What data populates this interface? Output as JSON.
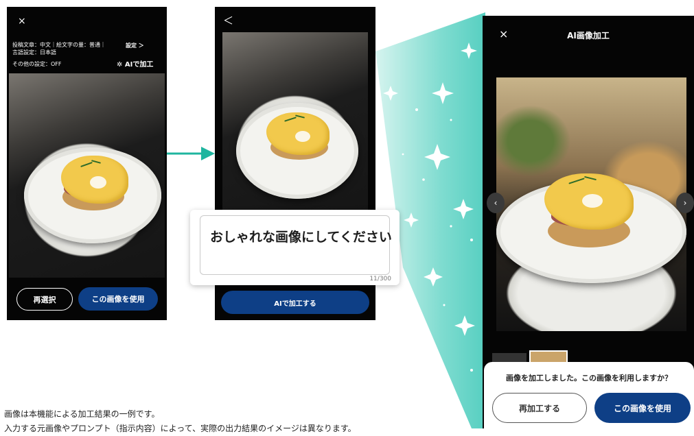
{
  "screen1": {
    "close_icon": "×",
    "settings_line1": "投稿文章：中文｜絵文字の量：普通｜",
    "settings_line2": "言語設定：日本語",
    "settings_line3": "その他の設定：OFF",
    "settings_link": "設定 ＞",
    "ai_edit": "AIで加工",
    "reselect_button": "再選択",
    "use_image_button": "この画像を使用"
  },
  "screen2": {
    "back_icon": "＜",
    "ai_process_button": "AIで加工する"
  },
  "prompt": {
    "text": "おしゃれな画像にしてください",
    "counter": "11/300"
  },
  "screen3": {
    "close_icon": "×",
    "title": "AI画像加工",
    "prev_icon": "‹",
    "next_icon": "›",
    "sheet_message": "画像を加工しました。この画像を利用しますか？",
    "reprocess_button": "再加工する",
    "use_image_button": "この画像を使用"
  },
  "caption": {
    "line1": "画像は本機能による加工結果の一例です。",
    "line2": "入力する元画像やプロンプト（指示内容）によって、実際の出力結果のイメージは異なります。"
  },
  "colors": {
    "accent_blue": "#0e3f86",
    "teal": "#5fd3c6"
  }
}
